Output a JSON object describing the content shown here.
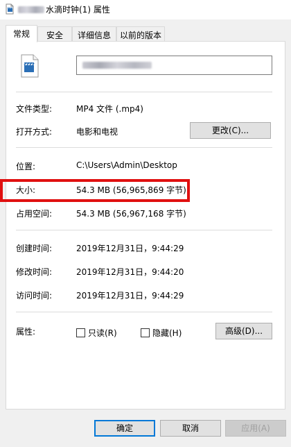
{
  "window": {
    "title": "水滴时钟(1) 属性"
  },
  "tabs": [
    {
      "label": "常规"
    },
    {
      "label": "安全"
    },
    {
      "label": "详细信息"
    },
    {
      "label": "以前的版本"
    }
  ],
  "general": {
    "file_type_label": "文件类型:",
    "file_type_value": "MP4 文件 (.mp4)",
    "open_with_label": "打开方式:",
    "open_with_value": "电影和电视",
    "change_button": "更改(C)...",
    "location_label": "位置:",
    "location_value": "C:\\Users\\Admin\\Desktop",
    "size_label": "大小:",
    "size_value": "54.3 MB (56,965,869 字节)",
    "size_on_disk_label": "占用空间:",
    "size_on_disk_value": "54.3 MB (56,967,168 字节)",
    "created_label": "创建时间:",
    "created_value": "2019年12月31日，9:44:29",
    "modified_label": "修改时间:",
    "modified_value": "2019年12月31日，9:44:20",
    "accessed_label": "访问时间:",
    "accessed_value": "2019年12月31日，9:44:29",
    "attributes_label": "属性:",
    "readonly_label": "只读(R)",
    "hidden_label": "隐藏(H)",
    "advanced_button": "高级(D)..."
  },
  "footer": {
    "ok_button": "确定",
    "cancel_button": "取消",
    "apply_button": "应用(A)"
  },
  "colors": {
    "highlight_border": "#e01010",
    "primary_border": "#0078d7"
  }
}
